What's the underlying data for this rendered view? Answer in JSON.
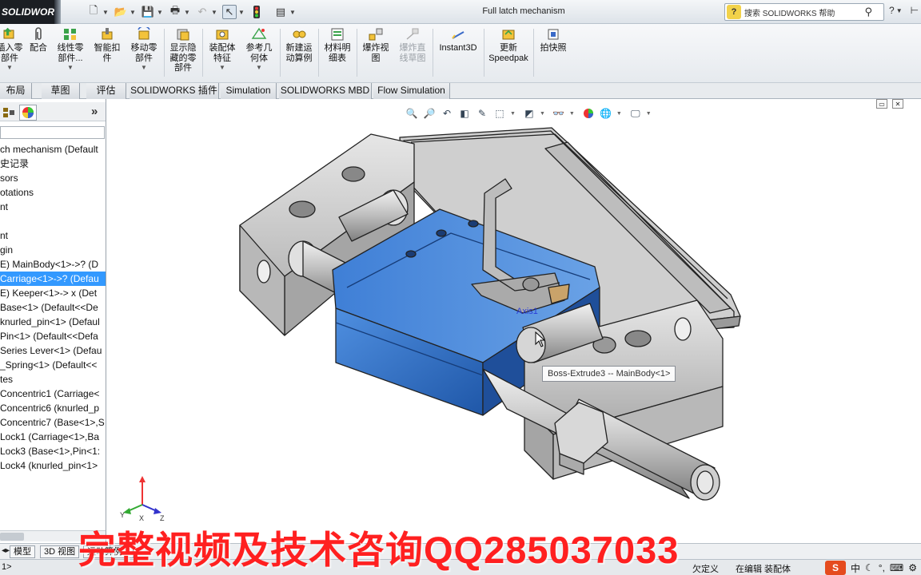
{
  "app": {
    "logo_text": "SOLIDWORKS",
    "document_title": "Full latch mechanism",
    "search_placeholder": "搜索 SOLIDWORKS 帮助"
  },
  "quick_access": [
    "new-document-icon",
    "open-folder-icon",
    "save-icon",
    "print-icon",
    "undo-icon",
    "select-arrow-icon",
    "rebuild-traffic-light-icon",
    "file-properties-icon"
  ],
  "ribbon": {
    "buttons": [
      {
        "label": "插入零\n部件",
        "icon": "insert-component-icon"
      },
      {
        "label": "配合",
        "icon": "mate-paperclip-icon"
      },
      {
        "label": "线性零\n部件...",
        "icon": "linear-pattern-icon"
      },
      {
        "label": "智能扣\n件",
        "icon": "smart-fasteners-icon"
      },
      {
        "label": "移动零\n部件",
        "icon": "move-component-icon"
      },
      {
        "label": "显示隐\n藏的零\n部件",
        "icon": "show-hidden-components-icon"
      },
      {
        "label": "装配体\n特征",
        "icon": "assembly-features-icon"
      },
      {
        "label": "参考几\n何体",
        "icon": "reference-geometry-icon"
      },
      {
        "label": "新建运\n动算例",
        "icon": "new-motion-study-icon"
      },
      {
        "label": "材料明\n细表",
        "icon": "bill-of-materials-icon"
      },
      {
        "label": "爆炸视\n图",
        "icon": "exploded-view-icon"
      },
      {
        "label": "爆炸直\n线草图",
        "icon": "explode-line-sketch-icon",
        "disabled": true
      },
      {
        "label": "Instant3D",
        "icon": "instant3d-icon"
      },
      {
        "label": "更新\nSpeedpak",
        "icon": "update-speedpak-icon"
      },
      {
        "label": "拍快照",
        "icon": "take-snapshot-icon"
      }
    ]
  },
  "command_tabs": [
    "布局",
    "草图",
    "评估",
    "SOLIDWORKS 插件",
    "Simulation",
    "SOLIDWORKS MBD",
    "Flow Simulation"
  ],
  "feature_tree": {
    "items": [
      {
        "text": "ch mechanism  (Default"
      },
      {
        "text": "史记录"
      },
      {
        "text": "sors"
      },
      {
        "text": "otations"
      },
      {
        "text": "nt"
      },
      {
        "text": ""
      },
      {
        "text": "nt"
      },
      {
        "text": "gin"
      },
      {
        "text": "E) MainBody<1>->? (D"
      },
      {
        "text": "Carriage<1>->? (Defau",
        "selected": true
      },
      {
        "text": "E) Keeper<1>-> x (Det"
      },
      {
        "text": "Base<1> (Default<<De"
      },
      {
        "text": "knurled_pin<1> (Defaul"
      },
      {
        "text": "Pin<1> (Default<<Defa"
      },
      {
        "text": "Series Lever<1> (Defau"
      },
      {
        "text": "_Spring<1> (Default<<"
      },
      {
        "text": "tes"
      },
      {
        "text": "Concentric1 (Carriage<"
      },
      {
        "text": "Concentric6 (knurled_p"
      },
      {
        "text": "Concentric7 (Base<1>,S"
      },
      {
        "text": "Lock1 (Carriage<1>,Ba"
      },
      {
        "text": "Lock3 (Base<1>,Pin<1:"
      },
      {
        "text": "Lock4 (knurled_pin<1>"
      }
    ]
  },
  "viewport": {
    "tooltip": "Boss-Extrude3 -- MainBody<1>",
    "axis_label": "Axis1",
    "triad": {
      "x": "X",
      "y": "Y",
      "z": "Z"
    },
    "model_colors": {
      "body": "#c8c8c8",
      "carriage": "#2f6fc8",
      "carriage_dark": "#1f4f9a",
      "outline": "#222222"
    }
  },
  "bottom_tabs": [
    "模型",
    "3D 视图",
    "运动算例 1"
  ],
  "status": {
    "left": "1>",
    "underdefined": "欠定义",
    "editing": "在编辑 装配体",
    "ime_label": "S",
    "ime_lang": "中"
  },
  "watermark": "完整视频及技术咨询QQ285037033"
}
